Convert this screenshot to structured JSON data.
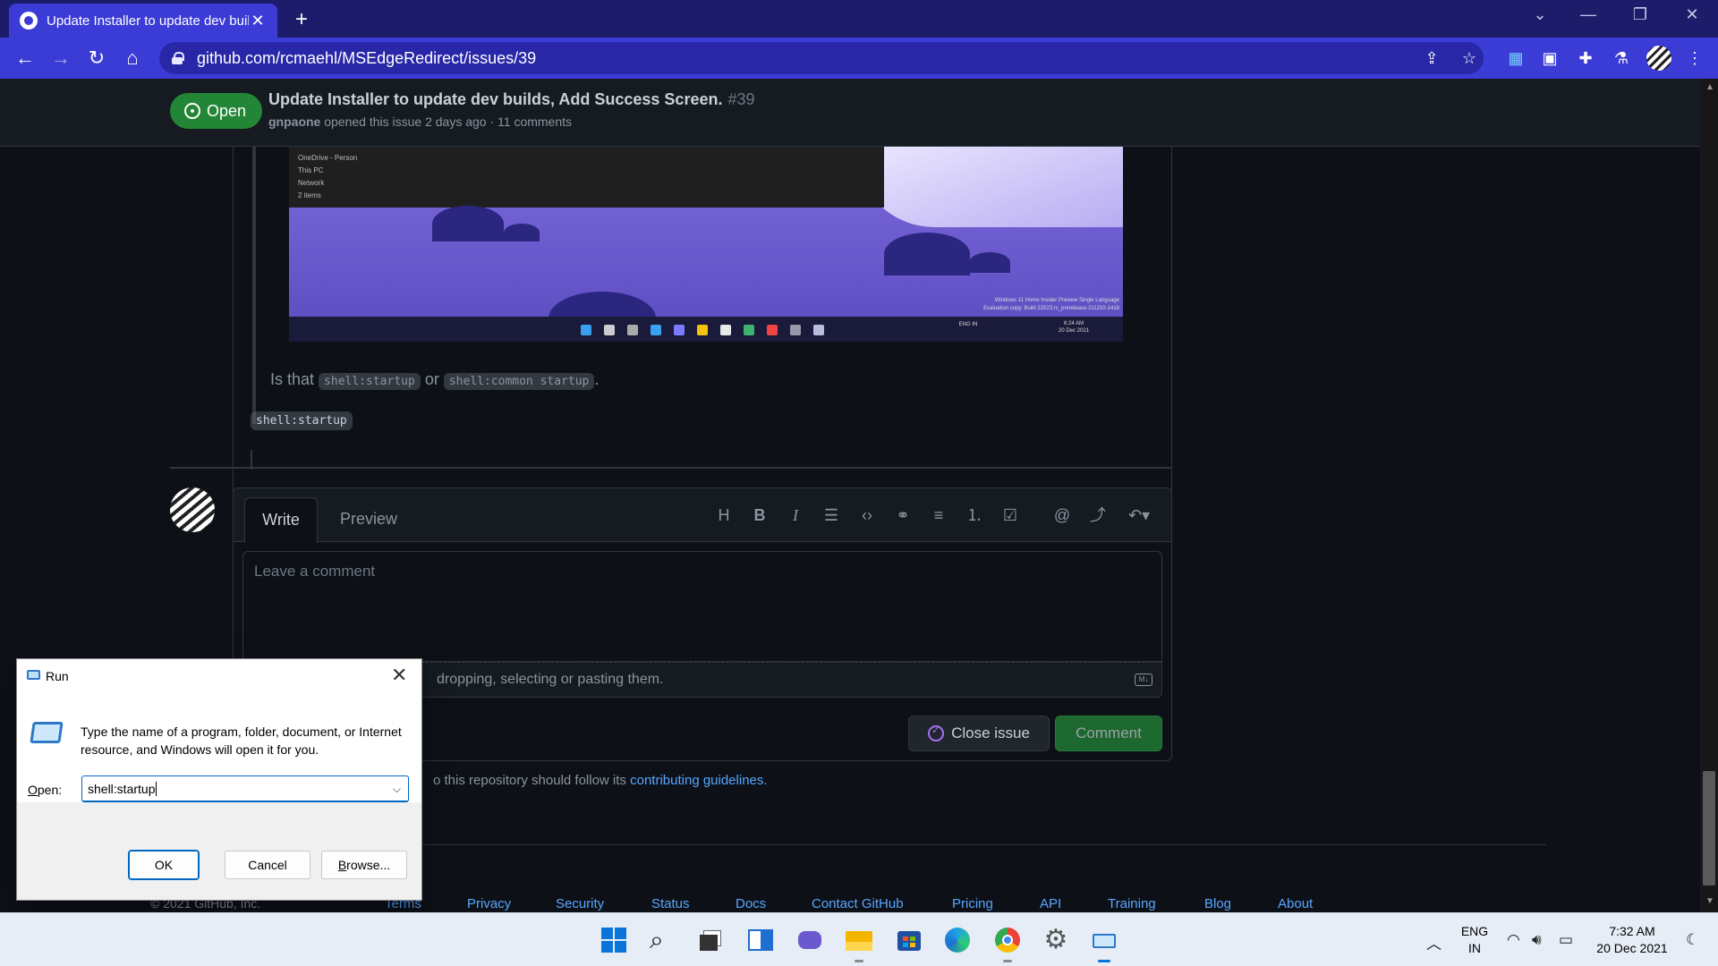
{
  "browser": {
    "tab_title": "Update Installer to update dev builds, Add Success Screen.",
    "url": "github.com/rcmaehl/MSEdgeRedirect/issues/39"
  },
  "issue": {
    "state": "Open",
    "title": "Update Installer to update dev builds, Add Success Screen.",
    "number": "#39",
    "author": "gnpaone",
    "meta_rest": "opened this issue 2 days ago · 11 comments"
  },
  "screenshot": {
    "explorer_items": [
      "OneDrive - Person",
      "This PC",
      "Network",
      "2 items"
    ],
    "watermark_line1": "Windows 11 Home Insider Preview Single Language",
    "watermark_line2": "Evaluation copy. Build 22523.rs_prerelease.211210-1418",
    "tray_lang": "ENG IN",
    "tray_time": "6:24 AM",
    "tray_date": "20 Dec 2021"
  },
  "quote": {
    "prefix": "Is that",
    "code1": "shell:startup",
    "middle": "or",
    "code2": "shell:common startup",
    "suffix": "."
  },
  "reply_code": "shell:startup",
  "editor": {
    "tab_write": "Write",
    "tab_preview": "Preview",
    "tools": [
      "H",
      "B",
      "I"
    ],
    "placeholder": "Leave a comment",
    "attach_hint": "dropping, selecting or pasting them.",
    "md_badge": "M↓",
    "close_issue": "Close issue",
    "comment": "Comment"
  },
  "guidelines": {
    "text": "o this repository should follow its",
    "link": "contributing guidelines",
    "end": "."
  },
  "footer": {
    "copyright": "© 2021 GitHub, Inc.",
    "links": [
      "Terms",
      "Privacy",
      "Security",
      "Status",
      "Docs",
      "Contact GitHub",
      "Pricing",
      "API",
      "Training",
      "Blog",
      "About"
    ]
  },
  "run_dialog": {
    "title": "Run",
    "description": "Type the name of a program, folder, document, or Internet resource, and Windows will open it for you.",
    "open_label": "Open:",
    "open_value": "shell:startup",
    "ok": "OK",
    "cancel": "Cancel",
    "browse": "Browse..."
  },
  "taskbar": {
    "lang_line1": "ENG",
    "lang_line2": "IN",
    "time": "7:32 AM",
    "date": "20 Dec 2021"
  },
  "icons": {
    "tab": "github-icon",
    "toolbar": [
      "back-icon",
      "forward-icon",
      "reload-icon",
      "home-icon",
      "lock-icon",
      "share-icon",
      "star-icon",
      "extensions-icon",
      "profile-icon",
      "menu-icon"
    ],
    "taskbar": [
      "start-icon",
      "search-icon",
      "task-view-icon",
      "widgets-icon",
      "chat-icon",
      "file-explorer-icon",
      "store-icon",
      "edge-dev-icon",
      "chrome-beta-icon",
      "settings-icon",
      "run-icon"
    ]
  },
  "colors": {
    "chrome_tabbar": "#1c1c6b",
    "chrome_toolbar": "#3b3bd6",
    "page_bg": "#0d1117",
    "open_green": "#238636",
    "link_blue": "#58a6ff",
    "taskbar_bg": "#e6edf6"
  }
}
